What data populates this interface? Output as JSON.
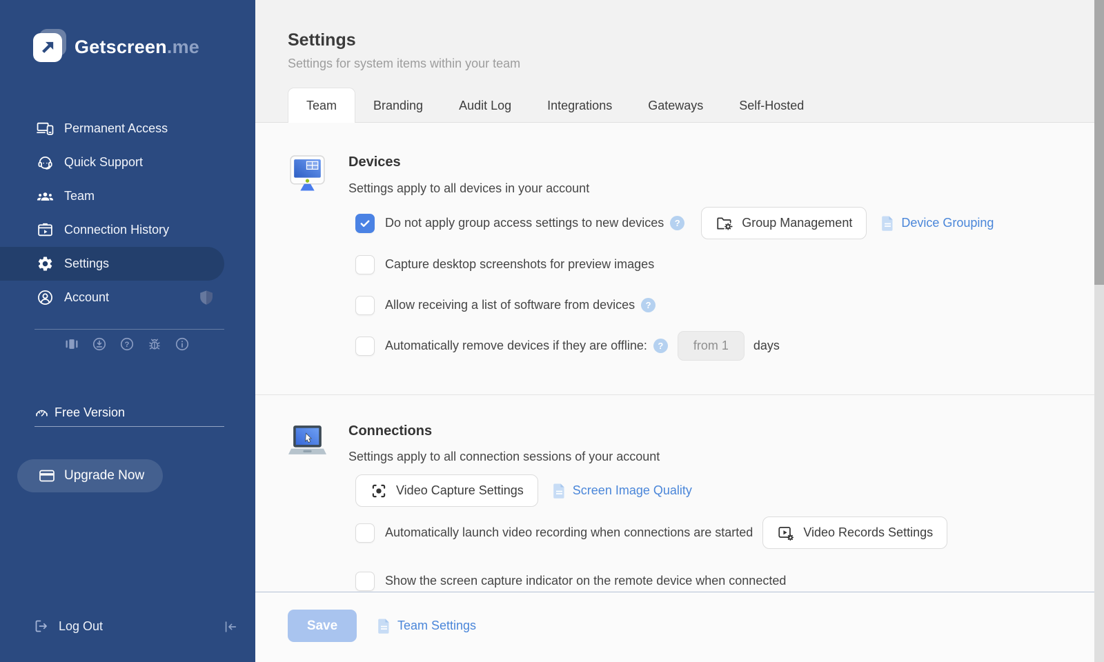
{
  "brand": {
    "name": "Getscreen",
    "suffix": ".me"
  },
  "sidebar": {
    "nav": [
      {
        "label": "Permanent Access",
        "active": false
      },
      {
        "label": "Quick Support",
        "active": false
      },
      {
        "label": "Team",
        "active": false
      },
      {
        "label": "Connection History",
        "active": false
      },
      {
        "label": "Settings",
        "active": true
      },
      {
        "label": "Account",
        "active": false
      }
    ],
    "plan_label": "Free Version",
    "upgrade_label": "Upgrade Now",
    "logout_label": "Log Out"
  },
  "header": {
    "title": "Settings",
    "subtitle": "Settings for system items within your team",
    "tabs": [
      {
        "label": "Team",
        "active": true
      },
      {
        "label": "Branding",
        "active": false
      },
      {
        "label": "Audit Log",
        "active": false
      },
      {
        "label": "Integrations",
        "active": false
      },
      {
        "label": "Gateways",
        "active": false
      },
      {
        "label": "Self-Hosted",
        "active": false
      }
    ]
  },
  "devices": {
    "title": "Devices",
    "subtitle": "Settings apply to all devices in your account",
    "checkbox_group_access": "Do not apply group access settings to new devices",
    "checkbox_group_access_checked": true,
    "group_management_button": "Group Management",
    "device_grouping_link": "Device Grouping",
    "checkbox_screenshots": "Capture desktop screenshots for preview images",
    "checkbox_screenshots_checked": false,
    "checkbox_software": "Allow receiving a list of software from devices",
    "checkbox_software_checked": false,
    "checkbox_offline": "Automatically remove devices if they are offline:",
    "checkbox_offline_checked": false,
    "offline_days_value": "from 1",
    "offline_days_unit": "days"
  },
  "connections": {
    "title": "Connections",
    "subtitle": "Settings apply to all connection sessions of your account",
    "video_capture_button": "Video Capture Settings",
    "screen_quality_link": "Screen Image Quality",
    "checkbox_autorecord": "Automatically launch video recording when connections are started",
    "checkbox_autorecord_checked": false,
    "video_records_button": "Video Records Settings",
    "checkbox_indicator": "Show the screen capture indicator on the remote device when connected",
    "checkbox_indicator_checked": false
  },
  "footer": {
    "save_label": "Save",
    "team_settings_link": "Team Settings"
  },
  "glyphs": {
    "question": "?"
  },
  "colors": {
    "sidebar_bg": "#2b4a80",
    "sidebar_active_bg": "#233f6c",
    "checkbox_checked": "#4a82e4",
    "link_blue": "#4a86d9",
    "header_bg": "#f2f2f2",
    "content_bg": "#fafafa",
    "save_disabled_bg": "#a9c4ef",
    "footer_border": "#b3c1d6"
  }
}
